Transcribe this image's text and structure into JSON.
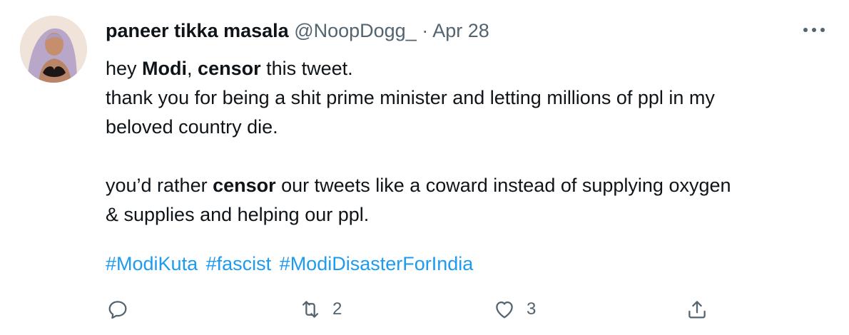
{
  "tweet": {
    "author": {
      "name": "paneer tikka masala",
      "handle": "@NoopDogg_",
      "separator": "·",
      "date": "Apr 28"
    },
    "more_label": "More",
    "body": {
      "line1": {
        "a": "hey ",
        "b": "Modi",
        "c": ", ",
        "d": "censor",
        "e": " this tweet."
      },
      "line2": "thank you for being a shit prime minister and letting millions of ppl in my",
      "line3": "beloved country die.",
      "line4": {
        "a": "you’d rather ",
        "b": "censor",
        "c": " our tweets like a coward instead of supplying oxygen"
      },
      "line5": "& supplies and helping our ppl."
    },
    "hashtags": [
      "#ModiKuta",
      "#fascist",
      "#ModiDisasterForIndia"
    ],
    "actions": {
      "reply_count": "",
      "retweet_count": "2",
      "like_count": "3"
    },
    "icons": {
      "reply": "reply-icon",
      "retweet": "retweet-icon",
      "like": "heart-icon",
      "share": "share-icon",
      "more": "more-icon"
    },
    "colors": {
      "text": "#0f1419",
      "secondary": "#536471",
      "link": "#1d9bf0"
    }
  }
}
